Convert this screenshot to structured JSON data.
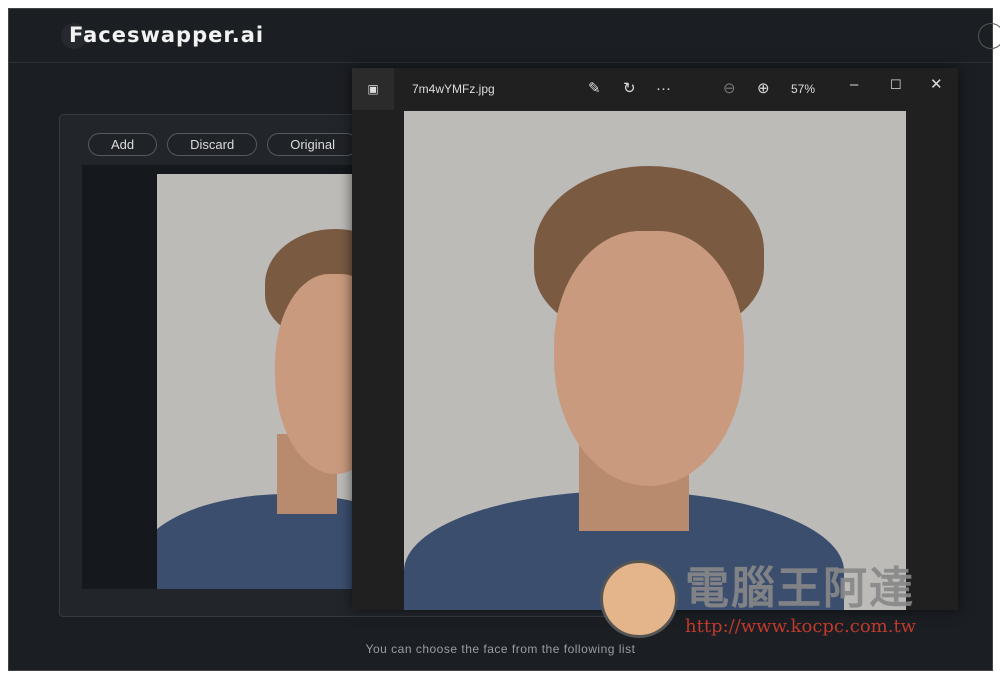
{
  "app": {
    "logo": "Faceswapper.ai",
    "hint": "You can choose the face from the following list"
  },
  "toolbar": {
    "add": "Add",
    "discard": "Discard",
    "original": "Original"
  },
  "viewer": {
    "filename": "7m4wYMFz.jpg",
    "zoom": "57%",
    "more": "···"
  },
  "watermark": {
    "title": "電腦王阿達",
    "url": "http://www.kocpc.com.tw"
  }
}
